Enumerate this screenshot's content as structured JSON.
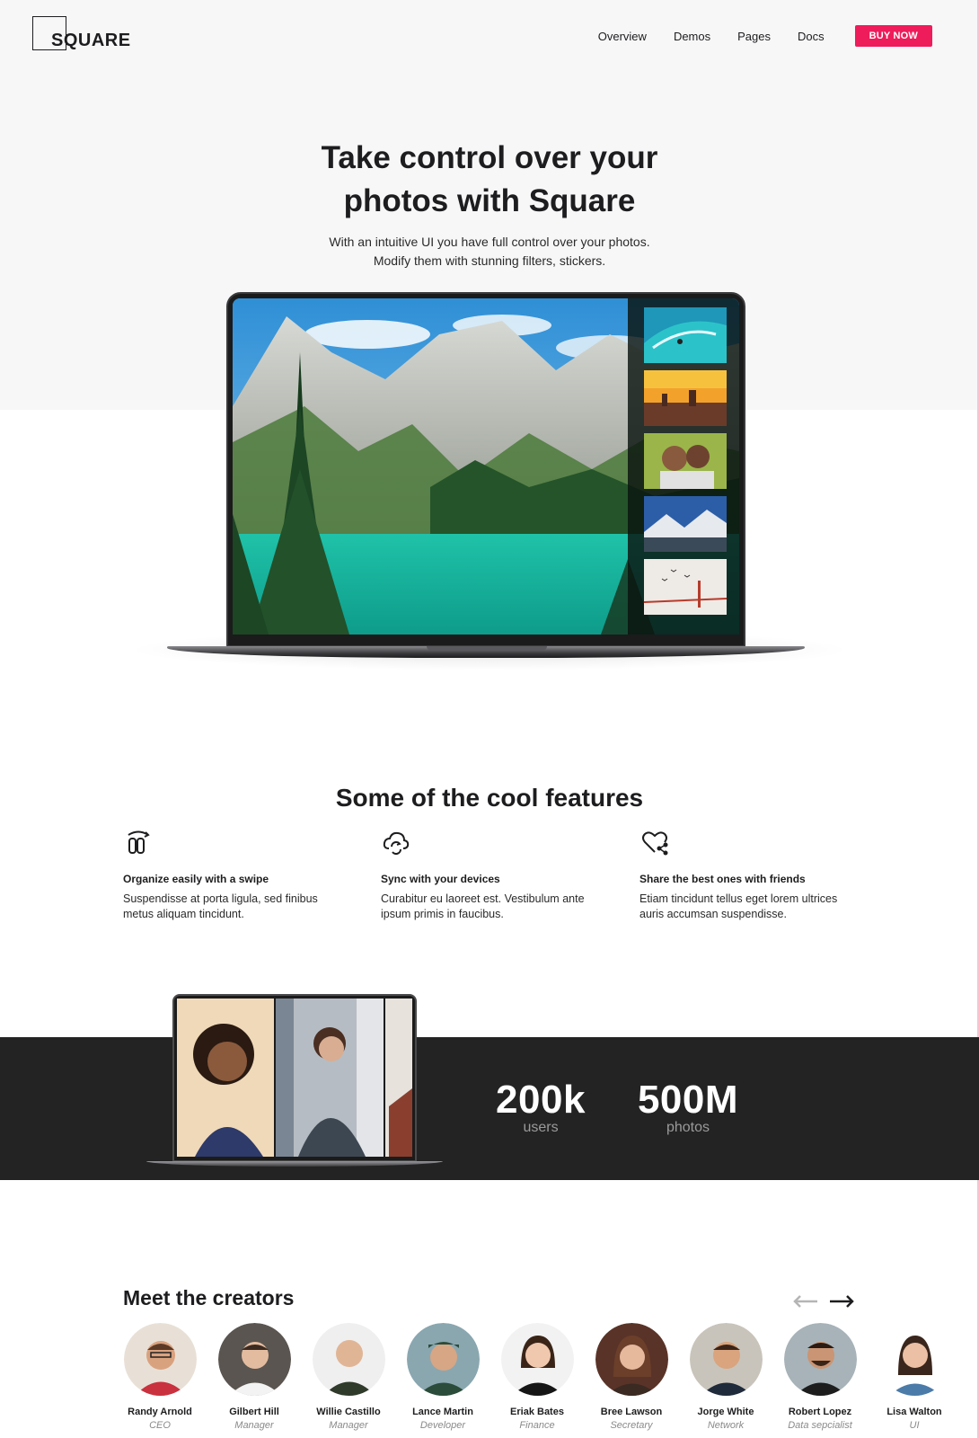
{
  "header": {
    "logo_text": "SQUARE",
    "nav": [
      "Overview",
      "Demos",
      "Pages",
      "Docs"
    ],
    "cta": "BUY NOW"
  },
  "hero": {
    "title_line1": "Take control over your",
    "title_line2": "photos with Square",
    "subtitle_line1": "With an intuitive UI you have full control over your photos.",
    "subtitle_line2": "Modify them with stunning filters, stickers."
  },
  "features": {
    "title": "Some of the cool features",
    "items": [
      {
        "icon": "swipe-hand-icon",
        "title": "Organize easily with a swipe",
        "desc_line1": "Suspendisse at porta ligula, sed finibus",
        "desc_line2": "metus aliquam tincidunt."
      },
      {
        "icon": "cloud-sync-icon",
        "title": "Sync with your devices",
        "desc_line1": "Curabitur eu laoreet est. Vestibulum ante",
        "desc_line2": "ipsum primis in faucibus."
      },
      {
        "icon": "heart-share-icon",
        "title": "Share the best ones with friends",
        "desc_line1": "Etiam tincidunt tellus eget lorem ultrices",
        "desc_line2": "auris accumsan suspendisse."
      }
    ]
  },
  "stats": [
    {
      "value": "200k",
      "label": "users"
    },
    {
      "value": "500M",
      "label": "photos"
    }
  ],
  "creators": {
    "title": "Meet the creators",
    "people": [
      {
        "name": "Randy Arnold",
        "role": "CEO"
      },
      {
        "name": "Gilbert Hill",
        "role": "Manager"
      },
      {
        "name": "Willie Castillo",
        "role": "Manager"
      },
      {
        "name": "Lance Martin",
        "role": "Developer"
      },
      {
        "name": "Eriak Bates",
        "role": "Finance"
      },
      {
        "name": "Bree Lawson",
        "role": "Secretary"
      },
      {
        "name": "Jorge White",
        "role": "Network"
      },
      {
        "name": "Robert Lopez",
        "role": "Data sepcialist"
      },
      {
        "name": "Lisa Walton",
        "role": "UI"
      }
    ]
  },
  "colors": {
    "accent": "#ee1c5a",
    "dark_band": "#232323",
    "hero_bg": "#f7f7f8"
  }
}
